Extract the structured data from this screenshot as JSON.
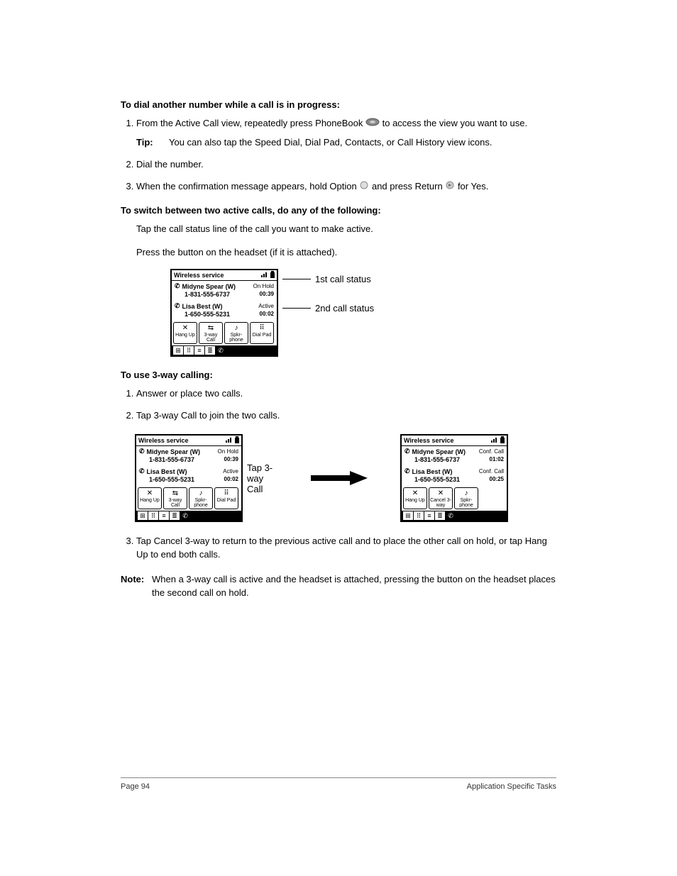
{
  "heading1": "To dial another number while a call is in progress:",
  "step1a_before": "From the Active Call view, repeatedly press PhoneBook ",
  "step1a_after": " to access the view you want to use.",
  "tip_label": "Tip:",
  "tip_text": "You can also tap the Speed Dial, Dial Pad, Contacts, or Call History view icons.",
  "step2": "Dial the number.",
  "step3_a": "When the confirmation message appears, hold Option ",
  "step3_b": " and press Return ",
  "step3_c": " for Yes.",
  "heading2": "To switch between two active calls, do any of the following:",
  "switch1": "Tap the call status line of the call you want to make active.",
  "switch2": "Press the button on the headset (if it is attached).",
  "callout1": "1st call status",
  "callout2": "2nd call status",
  "screenA": {
    "title": "Wireless service",
    "call1_name": "Midyne Spear (W)",
    "call1_status": "On Hold",
    "call1_number": "1-831-555-6737",
    "call1_time": "00:39",
    "call2_name": "Lisa Best (W)",
    "call2_status": "Active",
    "call2_number": "1-650-555-5231",
    "call2_time": "00:02",
    "btn1": "Hang Up",
    "btn2": "3-way Call",
    "btn3": "Spkr-phone",
    "btn4": "Dial Pad"
  },
  "heading3": "To use 3-way calling:",
  "use1": "Answer or place two calls.",
  "use2": "Tap 3-way Call to join the two calls.",
  "side_label": "Tap 3-way Call",
  "screenB": {
    "title": "Wireless service",
    "call1_name": "Midyne Spear (W)",
    "call1_status": "On Hold",
    "call1_number": "1-831-555-6737",
    "call1_time": "00:39",
    "call2_name": "Lisa Best (W)",
    "call2_status": "Active",
    "call2_number": "1-650-555-5231",
    "call2_time": "00:02",
    "btn1": "Hang Up",
    "btn2": "3-way Call",
    "btn3": "Spkr-phone",
    "btn4": "Dial Pad"
  },
  "screenC": {
    "title": "Wireless service",
    "call1_name": "Midyne Spear (W)",
    "call1_status": "Conf. Call",
    "call1_number": "1-831-555-6737",
    "call1_time": "01:02",
    "call2_name": "Lisa Best (W)",
    "call2_status": "Conf. Call",
    "call2_number": "1-650-555-5231",
    "call2_time": "00:25",
    "btn1": "Hang Up",
    "btn2": "Cancel 3-way",
    "btn3": "Spkr-phone"
  },
  "use3": "Tap Cancel 3-way to return to the previous active call and to place the other call on hold, or tap Hang Up to end both calls.",
  "note_label": "Note:",
  "note_text": "When a 3-way call is active and the headset is attached, pressing the button on the headset places the second call on hold.",
  "footer_left": "Page 94",
  "footer_right": "Application Specific Tasks"
}
